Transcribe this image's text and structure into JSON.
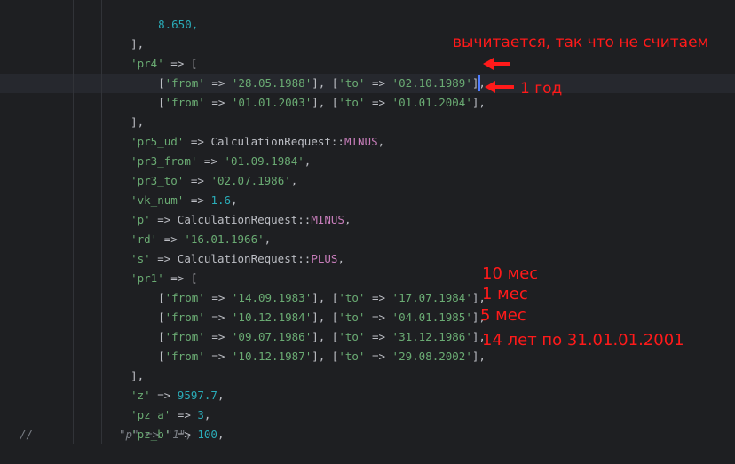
{
  "gutter": {
    "comment_marker": "//"
  },
  "code": {
    "l1_num": "8.650,",
    "l2": "],",
    "l3_key": "'pr4'",
    "l3_rest": " => [",
    "row_from": "['from' => ",
    "row_mid": "], ['to' => ",
    "row_end": "],",
    "pr4_rows": [
      {
        "from": "'28.05.1988'",
        "to": "'02.10.1989'"
      },
      {
        "from": "'01.01.2003'",
        "to": "'01.01.2004'"
      }
    ],
    "l6": "],",
    "pr5_key": "'pr5_ud'",
    "arrow": " => ",
    "calc": "CalculationRequest",
    "dcolon": "::",
    "minus": "MINUS",
    "plus": "PLUS",
    "comma": ",",
    "pr3_from_key": "'pr3_from'",
    "pr3_from_val": "'01.09.1984'",
    "pr3_to_key": "'pr3_to'",
    "pr3_to_val": "'02.07.1986'",
    "vk_key": "'vk_num'",
    "vk_val": "1.6",
    "p_key": "'p'",
    "rd_key": "'rd'",
    "rd_val": "'16.01.1966'",
    "s_key": "'s'",
    "pr1_key": "'pr1'",
    "open_bracket": " => [",
    "pr1_rows": [
      {
        "from": "'14.09.1983'",
        "to": "'17.07.1984'"
      },
      {
        "from": "'10.12.1984'",
        "to": "'04.01.1985'"
      },
      {
        "from": "'09.07.1986'",
        "to": "'31.12.1986'"
      },
      {
        "from": "'10.12.1987'",
        "to": "'29.08.2002'"
      }
    ],
    "close_bracket": "],",
    "z_key": "'z'",
    "z_val": "9597.7",
    "pza_key": "'pz_a'",
    "pza_val": "3",
    "pzb_key": "'pz_b'",
    "pzb_val": "100",
    "commented": "\"p\" => \"1\","
  },
  "annotations": {
    "a1": "вычитается, так что не считаем",
    "a2": "1 год",
    "a3": "10 мес",
    "a4": "1 мес",
    "a5": "5 мес",
    "a6": "14 лет по 31.01.01.2001"
  },
  "colors": {
    "annotation": "#ff1a1a",
    "string": "#6aab73",
    "number": "#2aacb8",
    "constant": "#c77dba"
  }
}
